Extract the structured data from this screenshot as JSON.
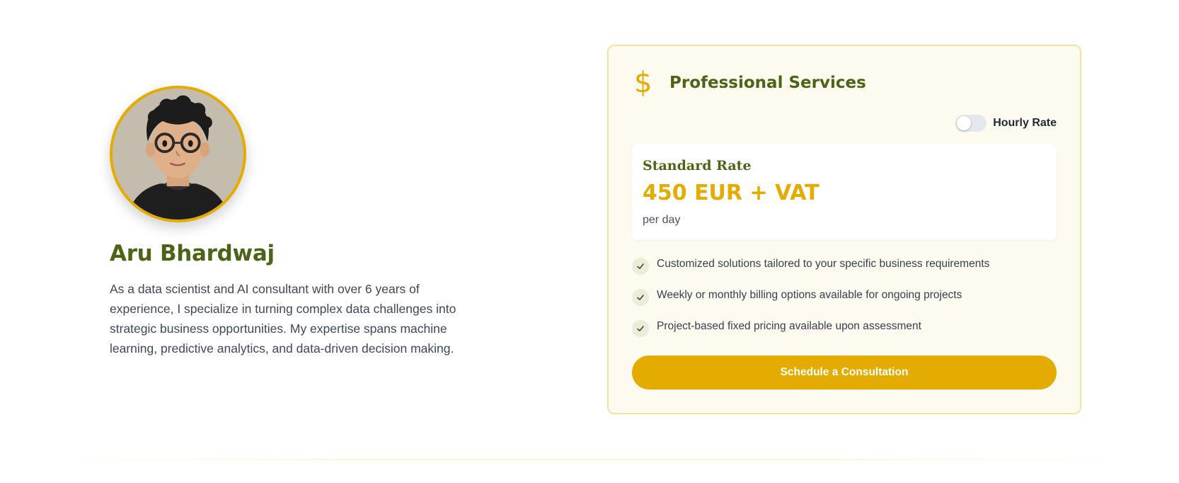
{
  "profile": {
    "name": "Aru Bhardwaj",
    "bio": "As a data scientist and AI consultant with over 6 years of experience, I specialize in turning complex data challenges into strategic business opportunities. My expertise spans machine learning, predictive analytics, and data-driven decision making."
  },
  "services": {
    "icon": "dollar-icon",
    "title": "Professional Services",
    "toggle": {
      "label": "Hourly Rate",
      "on": false
    },
    "rate": {
      "title": "Standard Rate",
      "price": "450 EUR + VAT",
      "unit": "per day"
    },
    "features": [
      "Customized solutions tailored to your specific business requirements",
      "Weekly or monthly billing options available for ongoing projects",
      "Project-based fixed pricing available upon assessment"
    ],
    "cta_label": "Schedule a Consultation"
  },
  "colors": {
    "accent": "#e4ab00",
    "heading_green": "#4d6416",
    "card_bg": "#fdfaf0",
    "card_border": "#f2e2a0"
  }
}
